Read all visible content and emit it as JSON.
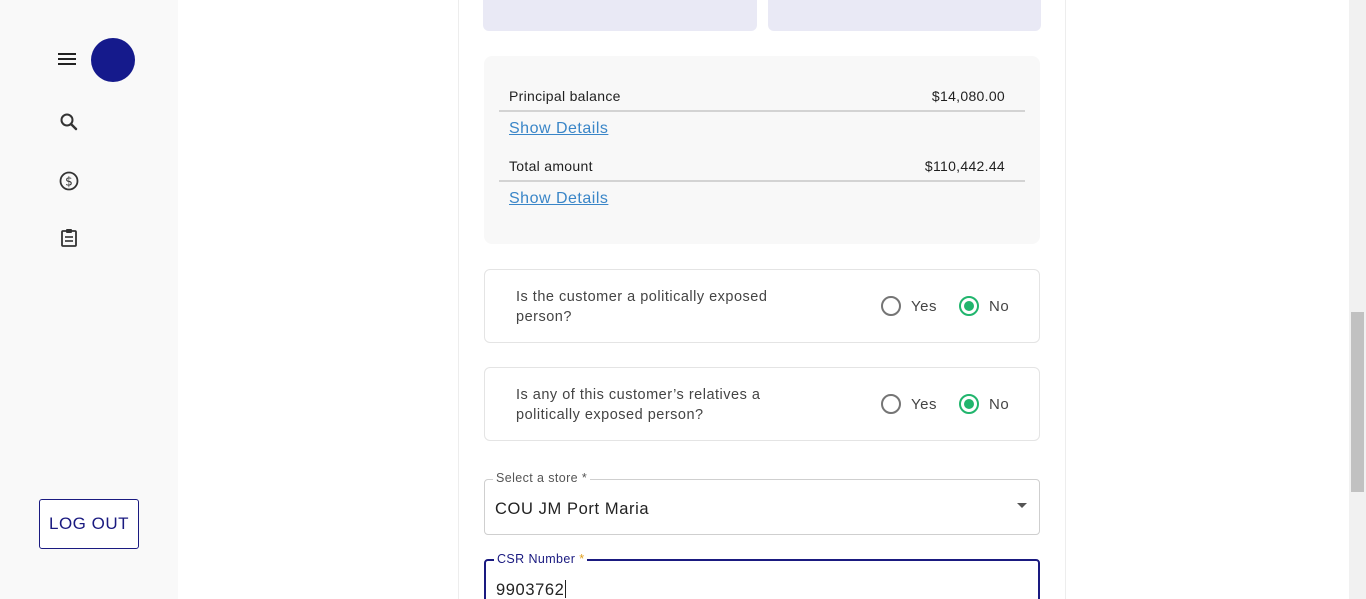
{
  "sidebar": {
    "menu_icon": "menu-icon",
    "avatar_color": "#151a8c",
    "nav": [
      {
        "icon": "search-icon"
      },
      {
        "icon": "dollar-circle-icon"
      },
      {
        "icon": "clipboard-icon"
      }
    ],
    "logout_label": "LOG OUT"
  },
  "balances": {
    "rows": [
      {
        "label": "Principal balance",
        "value": "$14,080.00",
        "link": "Show Details"
      },
      {
        "label": "Total amount",
        "value": "$110,442.44",
        "link": "Show Details"
      }
    ]
  },
  "questions": [
    {
      "text": "Is the customer a politically exposed person?",
      "yes_label": "Yes",
      "no_label": "No",
      "selected": "No"
    },
    {
      "text": "Is any of this customer’s relatives a politically exposed person?",
      "yes_label": "Yes",
      "no_label": "No",
      "selected": "No"
    }
  ],
  "store_field": {
    "label": "Select a store *",
    "value": "COU JM Port Maria"
  },
  "csr_field": {
    "label": "CSR Number",
    "required_mark": "*",
    "value": "9903762"
  },
  "colors": {
    "accent": "#1a1a80",
    "radio_checked": "#21b56d",
    "link": "#3a86c8"
  }
}
